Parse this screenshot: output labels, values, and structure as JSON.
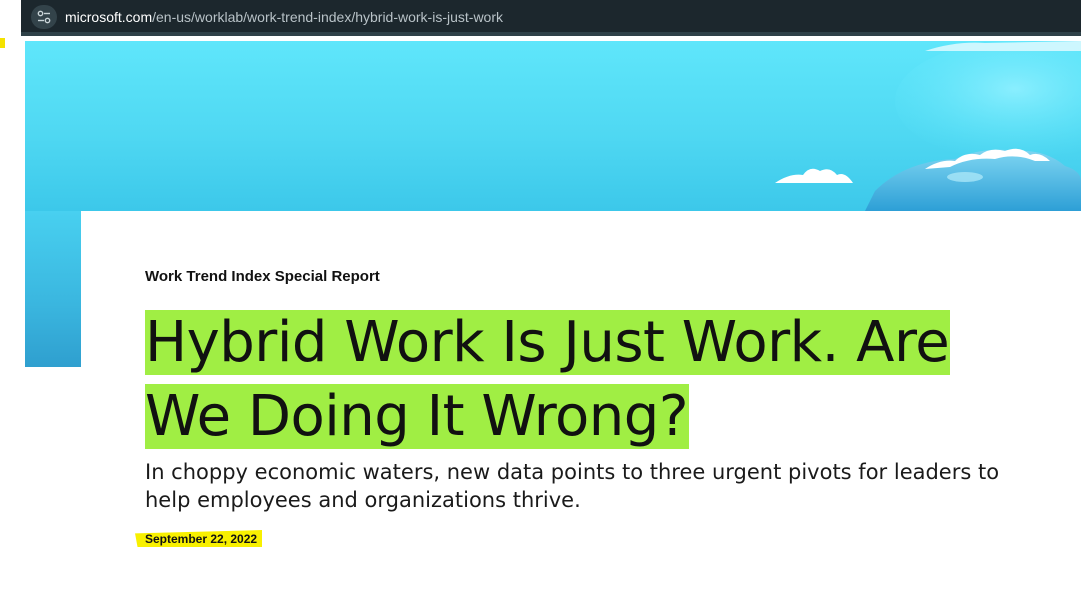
{
  "browser": {
    "url_domain": "microsoft.com",
    "url_path": "/en-us/worklab/work-trend-index/hybrid-work-is-just-work"
  },
  "article": {
    "eyebrow": "Work Trend Index Special Report",
    "headline_line1": "Hybrid Work Is Just Work. Are",
    "headline_line2": "We Doing It Wrong?",
    "subheading": "In choppy economic waters, new data points to three urgent pivots for leaders to help employees and organizations thrive.",
    "date": "September 22, 2022"
  },
  "colors": {
    "browser_bar": "#1c272d",
    "hero_sky": "#5fe6fb",
    "headline_highlight": "#a0ee44",
    "date_highlight": "#f8f000"
  },
  "icons": {
    "site_info": "tune-icon"
  }
}
